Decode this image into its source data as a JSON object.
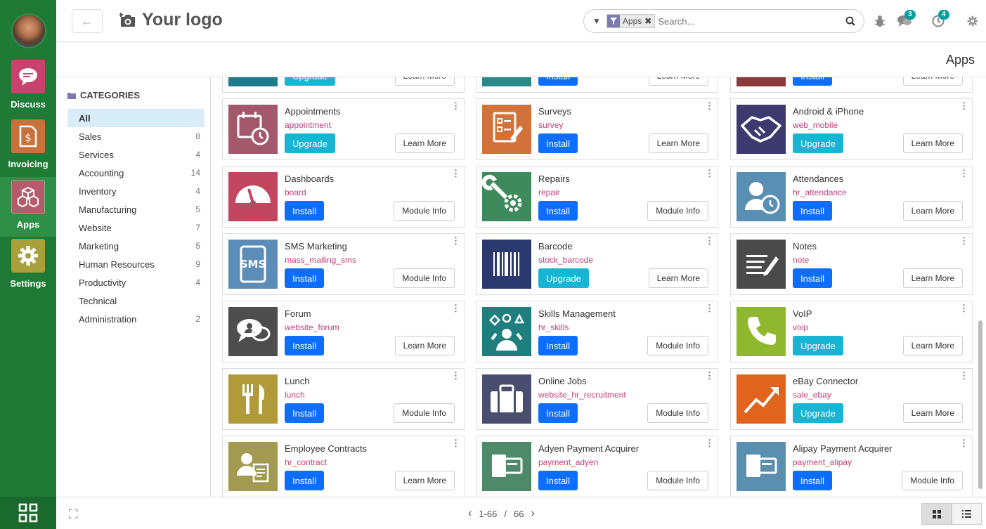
{
  "nav": {
    "apps": [
      {
        "label": "Discuss",
        "icon": "chat-bubble-icon",
        "color": "#c9416d"
      },
      {
        "label": "Invoicing",
        "icon": "invoice-icon",
        "color": "#c8713a"
      },
      {
        "label": "Apps",
        "icon": "cubes-icon",
        "color": "#b75b6c"
      },
      {
        "label": "Settings",
        "icon": "gear-icon",
        "color": "#a8a03a"
      }
    ]
  },
  "topbar": {
    "logo": "Your logo",
    "search": {
      "facet": "Apps",
      "placeholder": "Search..."
    },
    "messages_count": "3",
    "activities_count": "4"
  },
  "breadcrumb": "Apps",
  "categories": {
    "title": "CATEGORIES",
    "items": [
      {
        "label": "All",
        "count": ""
      },
      {
        "label": "Sales",
        "count": "8"
      },
      {
        "label": "Services",
        "count": "4"
      },
      {
        "label": "Accounting",
        "count": "14"
      },
      {
        "label": "Inventory",
        "count": "4"
      },
      {
        "label": "Manufacturing",
        "count": "5"
      },
      {
        "label": "Website",
        "count": "7"
      },
      {
        "label": "Marketing",
        "count": "5"
      },
      {
        "label": "Human Resources",
        "count": "9"
      },
      {
        "label": "Productivity",
        "count": "4"
      },
      {
        "label": "Technical",
        "count": ""
      },
      {
        "label": "Administration",
        "count": "2"
      }
    ]
  },
  "partial_row": [
    {
      "action": "Upgrade",
      "secondary": "Learn More",
      "color": "#1f7a8c"
    },
    {
      "action": "Install",
      "secondary": "Learn More",
      "color": "#2a8a8a"
    },
    {
      "action": "Install",
      "secondary": "Learn More",
      "color": "#8a3a3a"
    }
  ],
  "apps": [
    {
      "name": "Appointments",
      "tech": "appointment",
      "action": "Upgrade",
      "secondary": "Learn More",
      "icon": "calendar-clock-icon",
      "color": "#a3586b"
    },
    {
      "name": "Surveys",
      "tech": "survey",
      "action": "Install",
      "secondary": "Learn More",
      "icon": "checklist-icon",
      "color": "#d2713a"
    },
    {
      "name": "Android & iPhone",
      "tech": "web_mobile",
      "action": "Upgrade",
      "secondary": "Learn More",
      "icon": "handshake-icon",
      "color": "#3c3a6e"
    },
    {
      "name": "Dashboards",
      "tech": "board",
      "action": "Install",
      "secondary": "Module Info",
      "icon": "gauge-icon",
      "color": "#c24660"
    },
    {
      "name": "Repairs",
      "tech": "repair",
      "action": "Install",
      "secondary": "Module Info",
      "icon": "wrench-gear-icon",
      "color": "#3e8a5c"
    },
    {
      "name": "Attendances",
      "tech": "hr_attendance",
      "action": "Install",
      "secondary": "Learn More",
      "icon": "user-clock-icon",
      "color": "#5a8fb4"
    },
    {
      "name": "SMS Marketing",
      "tech": "mass_mailing_sms",
      "action": "Install",
      "secondary": "Module Info",
      "icon": "sms-phone-icon",
      "color": "#5b8db8"
    },
    {
      "name": "Barcode",
      "tech": "stock_barcode",
      "action": "Upgrade",
      "secondary": "Learn More",
      "icon": "barcode-icon",
      "color": "#2b3a6e"
    },
    {
      "name": "Notes",
      "tech": "note",
      "action": "Install",
      "secondary": "Learn More",
      "icon": "note-pencil-icon",
      "color": "#4a4a4a"
    },
    {
      "name": "Forum",
      "tech": "website_forum",
      "action": "Install",
      "secondary": "Learn More",
      "icon": "forum-bubbles-icon",
      "color": "#4d4d4d"
    },
    {
      "name": "Skills Management",
      "tech": "hr_skills",
      "action": "Install",
      "secondary": "Module Info",
      "icon": "skills-person-icon",
      "color": "#1f7f7f"
    },
    {
      "name": "VoIP",
      "tech": "voip",
      "action": "Upgrade",
      "secondary": "Learn More",
      "icon": "phone-icon",
      "color": "#8fb82e"
    },
    {
      "name": "Lunch",
      "tech": "lunch",
      "action": "Install",
      "secondary": "Module Info",
      "icon": "fork-knife-icon",
      "color": "#b09a3a"
    },
    {
      "name": "Online Jobs",
      "tech": "website_hr_recruitment",
      "action": "Install",
      "secondary": "Module Info",
      "icon": "briefcase-icon",
      "color": "#4a4e6e"
    },
    {
      "name": "eBay Connector",
      "tech": "sale_ebay",
      "action": "Upgrade",
      "secondary": "Learn More",
      "icon": "trend-chart-icon",
      "color": "#e0631e"
    },
    {
      "name": "Employee Contracts",
      "tech": "hr_contract",
      "action": "Install",
      "secondary": "Learn More",
      "icon": "contract-person-icon",
      "color": "#a39a52"
    },
    {
      "name": "Adyen Payment Acquirer",
      "tech": "payment_adyen",
      "action": "Install",
      "secondary": "Module Info",
      "icon": "payment-card-icon",
      "color": "#4e8a6a"
    },
    {
      "name": "Alipay Payment Acquirer",
      "tech": "payment_alipay",
      "action": "Install",
      "secondary": "Module Info",
      "icon": "payment-card-icon",
      "color": "#5b8fb0"
    }
  ],
  "pager": {
    "range": "1-66",
    "sep": "/",
    "total": "66"
  }
}
